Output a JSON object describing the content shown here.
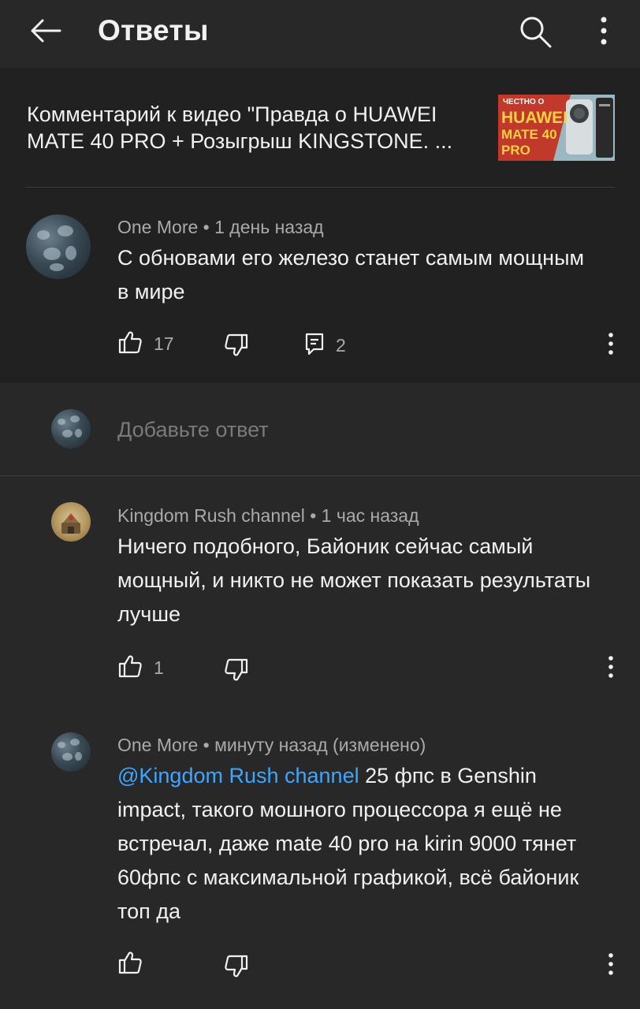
{
  "header": {
    "title": "Ответы"
  },
  "video_ref": {
    "text": "Комментарий к видео \"Правда о HUAWEI MATE 40 PRO + Розыгрыш KINGSTONE. ...",
    "thumb_lines": [
      "ЧЕСТНО О",
      "HUAWEI",
      "MATE 40",
      "PRO"
    ]
  },
  "parent_comment": {
    "author": "One More",
    "time": "1 день назад",
    "text": "С обновами его железо станет самым мощным в мире",
    "likes": "17",
    "replies": "2"
  },
  "reply_input": {
    "placeholder": "Добавьте ответ"
  },
  "replies": [
    {
      "author": "Kingdom Rush channel",
      "time": "1 час назад",
      "text": "Ничего подобного, Байоник сейчас самый мощный, и никто не может показать результаты лучше",
      "likes": "1"
    },
    {
      "author": "One More",
      "time": "минуту назад (изменено)",
      "mention": "@Kingdom Rush channel",
      "text": " 25 фпс в Genshin impact, такого мошного процессора я ещё не встречал, даже mate 40 pro на kirin 9000 тянет 60фпс с максимальной графикой, всё байоник топ да",
      "likes": ""
    }
  ],
  "separator": "•",
  "colors": {
    "background": "#282828",
    "parent_background": "#212121",
    "text": "#f1f1f1",
    "secondary_text": "#aaaaaa",
    "mention": "#3ea6ff"
  },
  "icons": [
    "back-arrow-icon",
    "search-icon",
    "more-vert-icon",
    "thumb-up-icon",
    "thumb-down-icon",
    "reply-icon"
  ]
}
